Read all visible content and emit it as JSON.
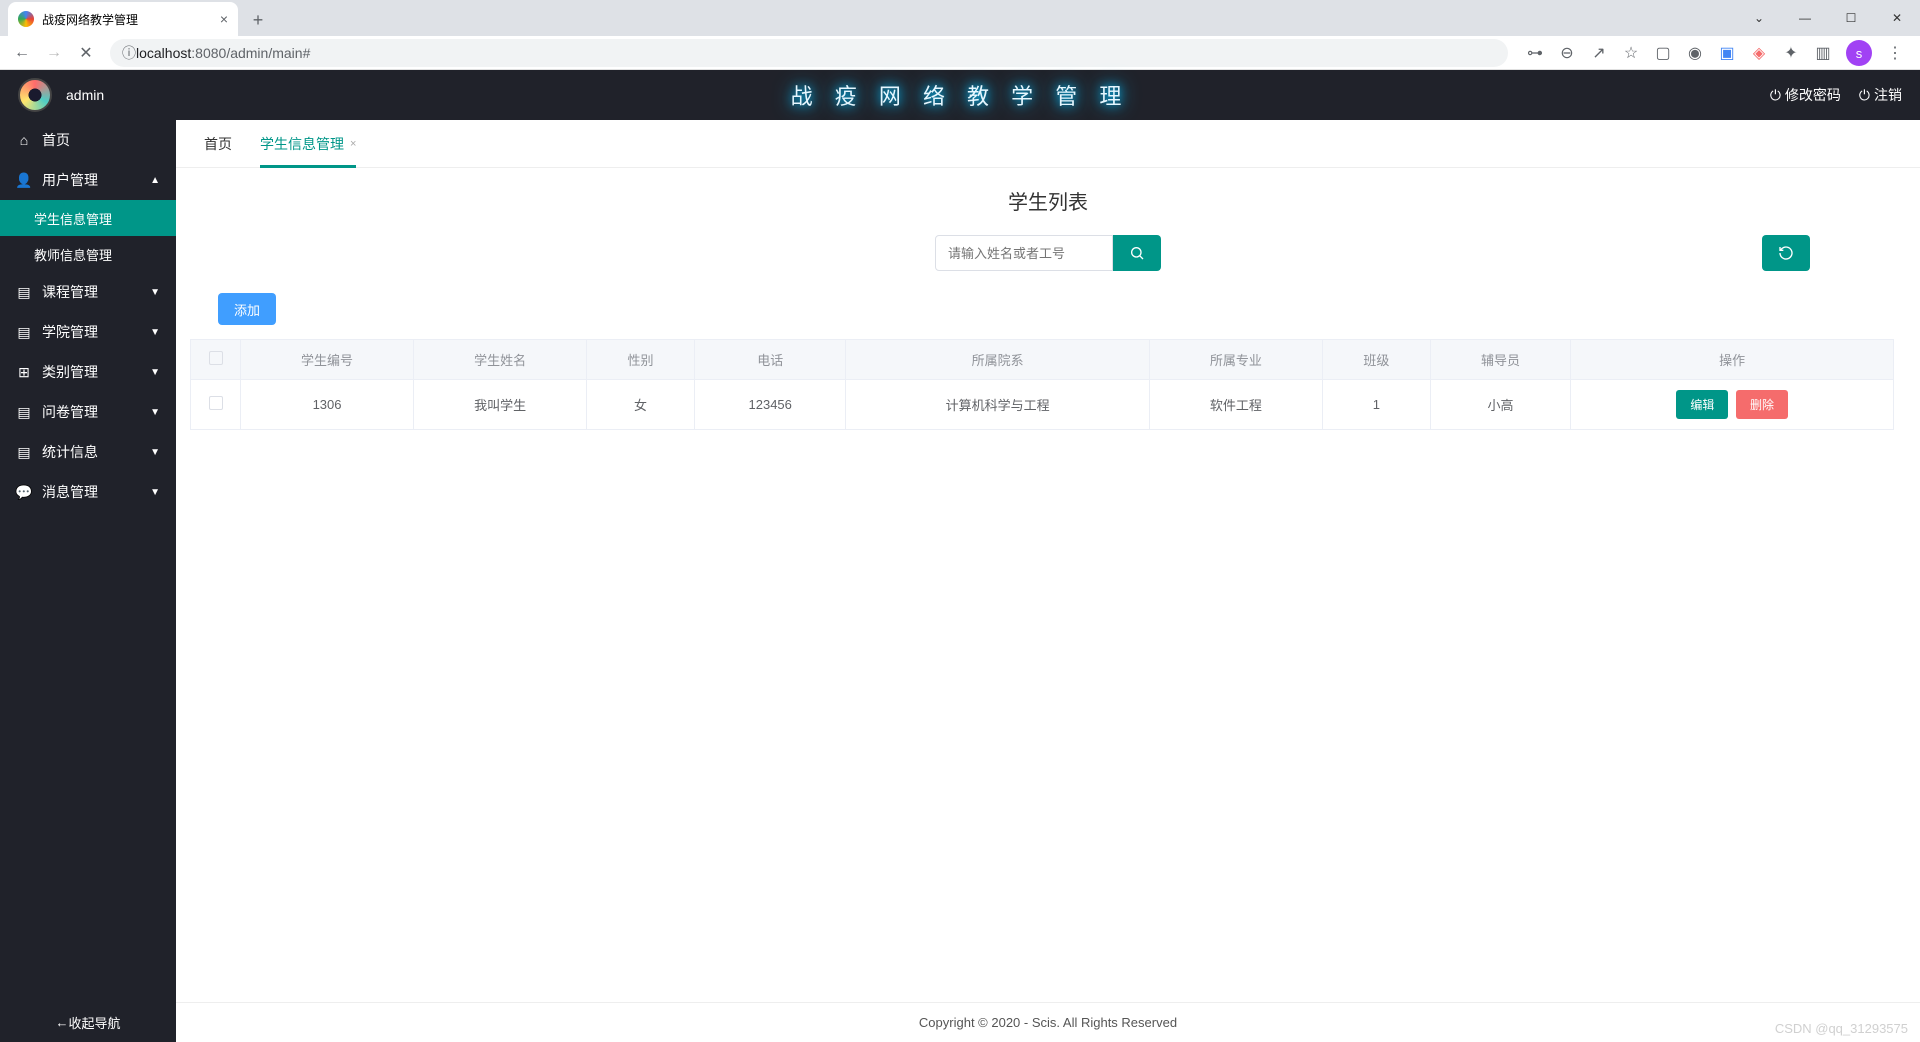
{
  "browser": {
    "tab_title": "战疫网络教学管理",
    "url_prefix": "ⓘ ",
    "url_host": "localhost",
    "url_port": ":8080",
    "url_path": "/admin/main#",
    "avatar_letter": "s"
  },
  "header": {
    "username": "admin",
    "app_title": "战 疫 网 络 教 学 管 理",
    "change_pwd": "修改密码",
    "logout": "注销"
  },
  "sidebar": {
    "items": [
      {
        "icon": "home",
        "label": "首页",
        "expandable": false
      },
      {
        "icon": "user",
        "label": "用户管理",
        "expandable": true,
        "expanded": true
      },
      {
        "icon": "doc",
        "label": "课程管理",
        "expandable": true
      },
      {
        "icon": "doc",
        "label": "学院管理",
        "expandable": true
      },
      {
        "icon": "plus",
        "label": "类别管理",
        "expandable": true
      },
      {
        "icon": "doc",
        "label": "问卷管理",
        "expandable": true
      },
      {
        "icon": "doc",
        "label": "统计信息",
        "expandable": true
      },
      {
        "icon": "chat",
        "label": "消息管理",
        "expandable": true
      }
    ],
    "sub_items": [
      {
        "label": "学生信息管理",
        "active": true
      },
      {
        "label": "教师信息管理",
        "active": false
      }
    ],
    "collapse": "收起导航"
  },
  "tabs": [
    {
      "label": "首页",
      "active": false,
      "closable": false
    },
    {
      "label": "学生信息管理",
      "active": true,
      "closable": true
    }
  ],
  "content": {
    "page_title": "学生列表",
    "search_placeholder": "请输入姓名或者工号",
    "add_label": "添加",
    "columns": [
      "",
      "学生编号",
      "学生姓名",
      "性别",
      "电话",
      "所属院系",
      "所属专业",
      "班级",
      "辅导员",
      "操作"
    ],
    "rows": [
      {
        "id": "1306",
        "name": "我叫学生",
        "gender": "女",
        "phone": "123456",
        "dept": "计算机科学与工程",
        "major": "软件工程",
        "class": "1",
        "tutor": "小高"
      }
    ],
    "edit_label": "编辑",
    "delete_label": "删除"
  },
  "footer": {
    "copyright": "Copyright © 2020 - Scis. All Rights Reserved",
    "watermark": "CSDN @qq_31293575"
  }
}
